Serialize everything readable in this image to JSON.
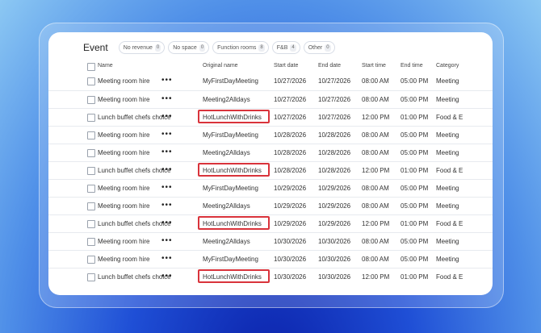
{
  "header": {
    "title": "Event",
    "chips": [
      {
        "label": "No revenue",
        "count": "0"
      },
      {
        "label": "No space",
        "count": "0"
      },
      {
        "label": "Function rooms",
        "count": "8"
      },
      {
        "label": "F&B",
        "count": "4"
      },
      {
        "label": "Other",
        "count": "0"
      }
    ]
  },
  "table": {
    "columns": [
      "Name",
      "Original name",
      "Start date",
      "End date",
      "Start time",
      "End time",
      "Category"
    ],
    "rows": [
      {
        "name": "Meeting room hire",
        "original": "MyFirstDayMeeting",
        "start_date": "10/27/2026",
        "end_date": "10/27/2026",
        "start_time": "08:00 AM",
        "end_time": "05:00 PM",
        "category": "Meeting",
        "highlighted": false
      },
      {
        "name": "Meeting room hire",
        "original": "Meeting2Alldays",
        "start_date": "10/27/2026",
        "end_date": "10/27/2026",
        "start_time": "08:00 AM",
        "end_time": "05:00 PM",
        "category": "Meeting",
        "highlighted": false
      },
      {
        "name": "Lunch buffet chefs choice",
        "original": "HotLunchWithDrinks",
        "start_date": "10/27/2026",
        "end_date": "10/27/2026",
        "start_time": "12:00 PM",
        "end_time": "01:00 PM",
        "category": "Food & E",
        "highlighted": true
      },
      {
        "name": "Meeting room hire",
        "original": "MyFirstDayMeeting",
        "start_date": "10/28/2026",
        "end_date": "10/28/2026",
        "start_time": "08:00 AM",
        "end_time": "05:00 PM",
        "category": "Meeting",
        "highlighted": false
      },
      {
        "name": "Meeting room hire",
        "original": "Meeting2Alldays",
        "start_date": "10/28/2026",
        "end_date": "10/28/2026",
        "start_time": "08:00 AM",
        "end_time": "05:00 PM",
        "category": "Meeting",
        "highlighted": false
      },
      {
        "name": "Lunch buffet chefs choice",
        "original": "HotLunchWithDrinks",
        "start_date": "10/28/2026",
        "end_date": "10/28/2026",
        "start_time": "12:00 PM",
        "end_time": "01:00 PM",
        "category": "Food & E",
        "highlighted": true
      },
      {
        "name": "Meeting room hire",
        "original": "MyFirstDayMeeting",
        "start_date": "10/29/2026",
        "end_date": "10/29/2026",
        "start_time": "08:00 AM",
        "end_time": "05:00 PM",
        "category": "Meeting",
        "highlighted": false
      },
      {
        "name": "Meeting room hire",
        "original": "Meeting2Alldays",
        "start_date": "10/29/2026",
        "end_date": "10/29/2026",
        "start_time": "08:00 AM",
        "end_time": "05:00 PM",
        "category": "Meeting",
        "highlighted": false
      },
      {
        "name": "Lunch buffet chefs choice",
        "original": "HotLunchWithDrinks",
        "start_date": "10/29/2026",
        "end_date": "10/29/2026",
        "start_time": "12:00 PM",
        "end_time": "01:00 PM",
        "category": "Food & E",
        "highlighted": true
      },
      {
        "name": "Meeting room hire",
        "original": "Meeting2Alldays",
        "start_date": "10/30/2026",
        "end_date": "10/30/2026",
        "start_time": "08:00 AM",
        "end_time": "05:00 PM",
        "category": "Meeting",
        "highlighted": false
      },
      {
        "name": "Meeting room hire",
        "original": "MyFirstDayMeeting",
        "start_date": "10/30/2026",
        "end_date": "10/30/2026",
        "start_time": "08:00 AM",
        "end_time": "05:00 PM",
        "category": "Meeting",
        "highlighted": false
      },
      {
        "name": "Lunch buffet chefs choice",
        "original": "HotLunchWithDrinks",
        "start_date": "10/30/2026",
        "end_date": "10/30/2026",
        "start_time": "12:00 PM",
        "end_time": "01:00 PM",
        "category": "Food & E",
        "highlighted": true
      }
    ]
  },
  "icons": {
    "row_menu": "more-horizontal-icon",
    "checkbox": "checkbox-icon"
  },
  "colors": {
    "highlight": "#d9333b",
    "background_top": "#8cc8f3",
    "background_bottom": "#0a1fa8"
  }
}
